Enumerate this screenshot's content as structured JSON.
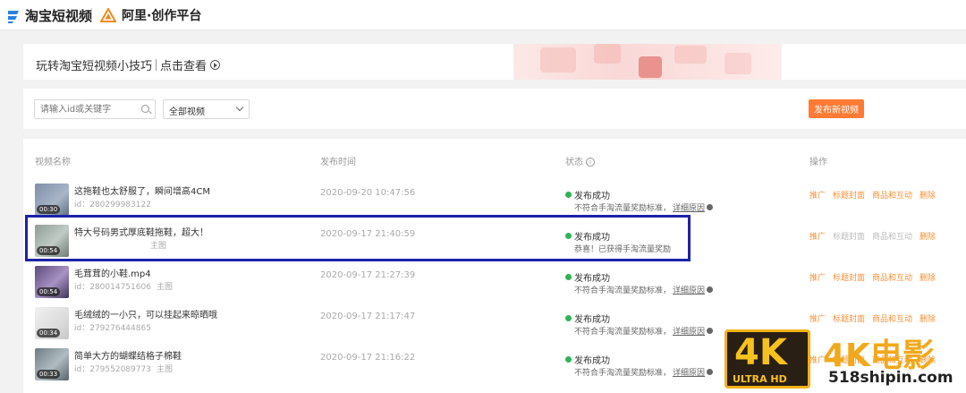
{
  "header": {
    "brand_primary": "淘宝短视频",
    "brand_secondary": "阿里·创作平台"
  },
  "banner": {
    "title": "玩转淘宝短视频小技巧",
    "link": "点击查看"
  },
  "filters": {
    "search_placeholder": "请输入id或关键字",
    "select_value": "全部视频",
    "publish_label": "发布新视频"
  },
  "table": {
    "headers": {
      "name": "视频名称",
      "time": "发布时间",
      "status": "状态",
      "ops": "操作"
    },
    "rows": [
      {
        "title": "这拖鞋也太舒服了，瞬间增高4CM",
        "id": "id：280299983122",
        "main": "",
        "duration": "00:30",
        "time": "2020-09-20 10:47:56",
        "status": "发布成功",
        "note": "不符合手淘流量奖励标准，",
        "detail": "详细原因",
        "thumb_color": "#8a9bb5"
      },
      {
        "title": "特大号码男式厚底鞋拖鞋，超大！",
        "id": "",
        "main": "主图",
        "duration": "00:54",
        "time": "2020-09-17 21:40:59",
        "status": "发布成功",
        "note": "恭喜！已获得手淘流量奖励",
        "detail": "",
        "thumb_color": "#9aa7a0"
      },
      {
        "title": "毛茸茸的小鞋.mp4",
        "id": "id：280014751606",
        "main": "主图",
        "duration": "00:54",
        "time": "2020-09-17 21:27:39",
        "status": "发布成功",
        "note": "不符合手淘流量奖励标准，",
        "detail": "详细原因",
        "thumb_color": "#6b5a86"
      },
      {
        "title": "毛绒绒的一小只，可以挂起来晾晒哦",
        "id": "id：279276444865",
        "main": "",
        "duration": "00:34",
        "time": "2020-09-17 21:17:47",
        "status": "发布成功",
        "note": "不符合手淘流量奖励标准，",
        "detail": "详细原因",
        "thumb_color": "#e6e6e6"
      },
      {
        "title": "简单大方的蝴蝶结格子棉鞋",
        "id": "id：279552089773",
        "main": "主图",
        "duration": "00:33",
        "time": "2020-09-17 21:16:22",
        "status": "发布成功",
        "note": "不符合手淘流量奖励标准，",
        "detail": "详细原因",
        "thumb_color": "#7d8a91"
      }
    ],
    "ops": [
      "推广",
      "标题封面",
      "商品和互动",
      "删除"
    ]
  },
  "watermark": {
    "badge_main": "4K",
    "badge_sub": "ULTRA HD",
    "title": "4K电影",
    "site": "518shipin.com"
  }
}
